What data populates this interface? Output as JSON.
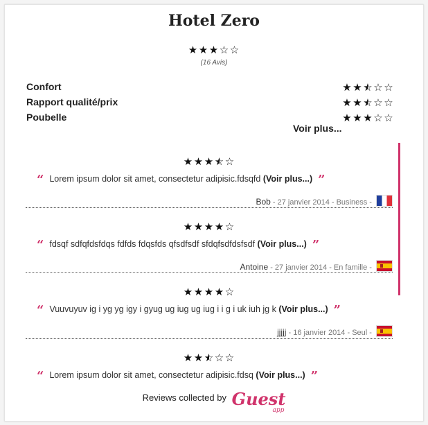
{
  "hotel": {
    "name": "Hotel Zero",
    "rating": 3,
    "reviews_count": "(16 Avis)"
  },
  "criteria": [
    {
      "label": "Confort",
      "rating": 2.5
    },
    {
      "label": "Rapport qualité/prix",
      "rating": 2.5
    },
    {
      "label": "Poubelle",
      "rating": 3
    }
  ],
  "more_label": "Voir plus...",
  "reviews": [
    {
      "rating": 3.5,
      "text": "Lorem ipsum dolor sit amet, consectetur adipisic.fdsqfd",
      "read_more": "(Voir plus...)",
      "author": "Bob",
      "details": " - 27 janvier 2014 - Business - ",
      "flag": "fr"
    },
    {
      "rating": 4,
      "text": "fdsqf sdfqfdsfdqs fdfds fdqsfds qfsdfsdf sfdqfsdfdsfsdf",
      "read_more": "(Voir plus...)",
      "author": "Antoine",
      "details": " - 27 janvier 2014 - En famille - ",
      "flag": "es"
    },
    {
      "rating": 4,
      "text": "Vuuvuyuv ig i yg yg igy i gyug ug iug ug iug i i g i uk iuh jg k",
      "read_more": "(Voir plus...)",
      "author": "jjjjj",
      "details": " - 16 janvier 2014 - Seul - ",
      "flag": "es"
    },
    {
      "rating": 2.5,
      "text": "Lorem ipsum dolor sit amet, consectetur adipisic.fdsq",
      "read_more": "(Voir plus...)"
    }
  ],
  "footer": {
    "label": "Reviews collected by",
    "logo_text": "Guest",
    "logo_sub": "app"
  },
  "colors": {
    "accent": "#d0336b",
    "text": "#222222",
    "border": "#e3e3e3"
  },
  "icons": {
    "star": "star-icon",
    "open_quote": "open-quote-icon",
    "close_quote": "close-quote-icon"
  }
}
